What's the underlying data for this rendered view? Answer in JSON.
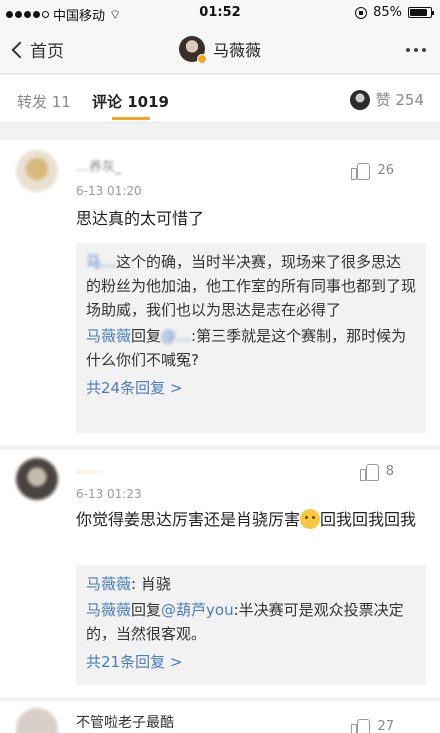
{
  "status_bar": {
    "carrier": "中国移动",
    "time": "01:52",
    "battery": "85%",
    "battery_level": 0.85
  },
  "nav": {
    "back_label": "首页",
    "title": "马薇薇"
  },
  "tabs": {
    "repost": "转发 11",
    "comment": "评论 1019",
    "like": "赞 254"
  },
  "comments": [
    {
      "name": "…养灰_",
      "time": "6-13 01:20",
      "likes": "26",
      "text": "思达真的太可惜了",
      "replies": [
        {
          "name": "马…",
          "text": "这个的确，当时半决赛，现场来了很多思达的粉丝为他加油，他工作室的所有同事也都到了现场助威，我们也以为思达是志在必得了"
        },
        {
          "name": "马薇薇",
          "mid": "回复",
          "mention": "@…",
          "text": ":第三季就是这个赛制，那时候为什么你们不喊冤?"
        }
      ],
      "more": "共24条回复 >"
    },
    {
      "name": "……",
      "time": "6-13 01:23",
      "likes": "8",
      "text_before": "你觉得姜思达厉害还是肖骁厉害",
      "text_after": "回我回我回我",
      "replies": [
        {
          "name": "马薇薇",
          "text": ": 肖骁"
        },
        {
          "name": "马薇薇",
          "mid": "回复",
          "mention": "@葫芦you",
          "text": ":半决赛可是观众投票决定的，当然很客观。"
        }
      ],
      "more": "共21条回复 >"
    },
    {
      "name": "不管啦老子最酷",
      "likes": "27"
    }
  ]
}
